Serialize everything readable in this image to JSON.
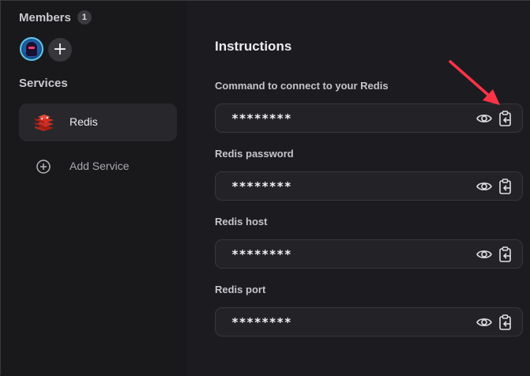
{
  "sidebar": {
    "members_label": "Members",
    "members_count": "1",
    "avatar_icon": "user-avatar",
    "add_member_symbol": "+",
    "services_label": "Services",
    "services": [
      {
        "label": "Redis",
        "icon": "redis-icon",
        "selected": true
      }
    ],
    "add_service_label": "Add Service"
  },
  "main": {
    "title": "Instructions",
    "fields": [
      {
        "label": "Command to connect to your Redis",
        "value": "********"
      },
      {
        "label": "Redis password",
        "value": "********"
      },
      {
        "label": "Redis host",
        "value": "********"
      },
      {
        "label": "Redis port",
        "value": "********"
      }
    ]
  },
  "colors": {
    "background": "#1a1a1e",
    "card": "#28282c",
    "field": "#232327",
    "arrow": "#ff3347",
    "redis_red": "#d82c20"
  }
}
